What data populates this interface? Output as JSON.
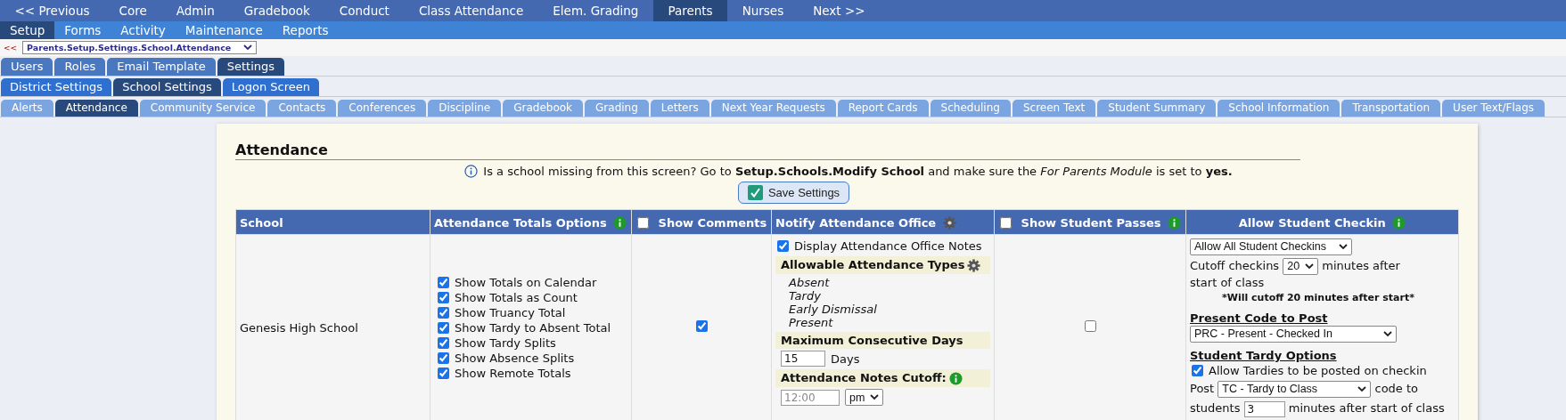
{
  "top_menu": [
    {
      "label": "<< Previous",
      "selected": false
    },
    {
      "label": "Core",
      "selected": false
    },
    {
      "label": "Admin",
      "selected": false
    },
    {
      "label": "Gradebook",
      "selected": false
    },
    {
      "label": "Conduct",
      "selected": false
    },
    {
      "label": "Class Attendance",
      "selected": false
    },
    {
      "label": "Elem. Grading",
      "selected": false
    },
    {
      "label": "Parents",
      "selected": true
    },
    {
      "label": "Nurses",
      "selected": false
    },
    {
      "label": "Next >>",
      "selected": false
    }
  ],
  "sub_menu": [
    {
      "label": "Setup",
      "selected": true
    },
    {
      "label": "Forms",
      "selected": false
    },
    {
      "label": "Activity",
      "selected": false
    },
    {
      "label": "Maintenance",
      "selected": false
    },
    {
      "label": "Reports",
      "selected": false
    }
  ],
  "breadcrumb": {
    "back": "<<",
    "path": "Parents.Setup.Settings.School.Attendance"
  },
  "tabs_level1": [
    {
      "label": "Users",
      "selected": false
    },
    {
      "label": "Roles",
      "selected": false
    },
    {
      "label": "Email Template",
      "selected": false
    },
    {
      "label": "Settings",
      "selected": true
    }
  ],
  "tabs_level2": [
    {
      "label": "District Settings",
      "selected": false
    },
    {
      "label": "School Settings",
      "selected": true
    },
    {
      "label": "Logon Screen",
      "selected": false
    }
  ],
  "tabs_level3": [
    {
      "label": "Alerts",
      "selected": false
    },
    {
      "label": "Attendance",
      "selected": true
    },
    {
      "label": "Community Service",
      "selected": false
    },
    {
      "label": "Contacts",
      "selected": false
    },
    {
      "label": "Conferences",
      "selected": false
    },
    {
      "label": "Discipline",
      "selected": false
    },
    {
      "label": "Gradebook",
      "selected": false
    },
    {
      "label": "Grading",
      "selected": false
    },
    {
      "label": "Letters",
      "selected": false
    },
    {
      "label": "Next Year Requests",
      "selected": false
    },
    {
      "label": "Report Cards",
      "selected": false
    },
    {
      "label": "Scheduling",
      "selected": false
    },
    {
      "label": "Screen Text",
      "selected": false
    },
    {
      "label": "Student Summary",
      "selected": false
    },
    {
      "label": "School Information",
      "selected": false
    },
    {
      "label": "Transportation",
      "selected": false
    },
    {
      "label": "User Text/Flags",
      "selected": false
    }
  ],
  "section_title": "Attendance",
  "info_message": "Is a school missing from this screen? Go to **Setup.Schools.Modify School** and make sure the *For Parents Module* is set to **yes.**",
  "save_button": "Save Settings",
  "table": {
    "columns": [
      {
        "label": "School",
        "kind": "plain"
      },
      {
        "label": "Attendance Totals Options",
        "kind": "plain"
      },
      {
        "label": "Show Comments",
        "kind": "checkbox",
        "checked": false
      },
      {
        "label": "Notify Attendance Office",
        "kind": "plain"
      },
      {
        "label": "Show Student Passes",
        "kind": "checkbox",
        "checked": false
      },
      {
        "label": "Allow Student Checkin",
        "kind": "plain"
      }
    ],
    "rows": [
      {
        "school": "Genesis High School",
        "totals_options": [
          {
            "label": "Show Totals on Calendar",
            "checked": true
          },
          {
            "label": "Show Totals as Count",
            "checked": true
          },
          {
            "label": "Show Truancy Total",
            "checked": true
          },
          {
            "label": "Show Tardy to Absent Total",
            "checked": true
          },
          {
            "label": "Show Tardy Splits",
            "checked": true
          },
          {
            "label": "Show Absence Splits",
            "checked": true
          },
          {
            "label": "Show Remote Totals",
            "checked": true
          }
        ],
        "show_comments": true,
        "notify": {
          "display_notes": {
            "label": "Display Attendance Office Notes",
            "checked": true
          },
          "types_heading": "Allowable Attendance Types",
          "types": [
            "Absent",
            "Tardy",
            "Early Dismissal",
            "Present"
          ],
          "max_days_heading": "Maximum Consecutive Days",
          "max_days": "15",
          "days_unit": "Days",
          "cutoff_heading": "Attendance Notes Cutoff:",
          "cutoff_time_placeholder": "12:00",
          "cutoff_ampm": "pm"
        },
        "show_passes": false,
        "checkin": {
          "mode": "Allow All Student Checkins",
          "cutoff_label": "Cutoff checkins",
          "cutoff_minutes": "20",
          "cutoff_after": "minutes after",
          "cutoff_after_line2": "start of class",
          "cutoff_note": "*Will cutoff 20 minutes after start*",
          "present_heading": "Present Code to Post",
          "present_code": "PRC - Present - Checked In",
          "tardy_heading": "Student Tardy Options",
          "allow_tardies": {
            "label": "Allow Tardies to be posted on checkin",
            "checked": true
          },
          "post_label": "Post",
          "post_code": "TC - Tardy to Class",
          "code_to": "code to",
          "students_label": "students",
          "students_minutes": "3",
          "minutes_after": "minutes after start of class"
        }
      }
    ]
  }
}
